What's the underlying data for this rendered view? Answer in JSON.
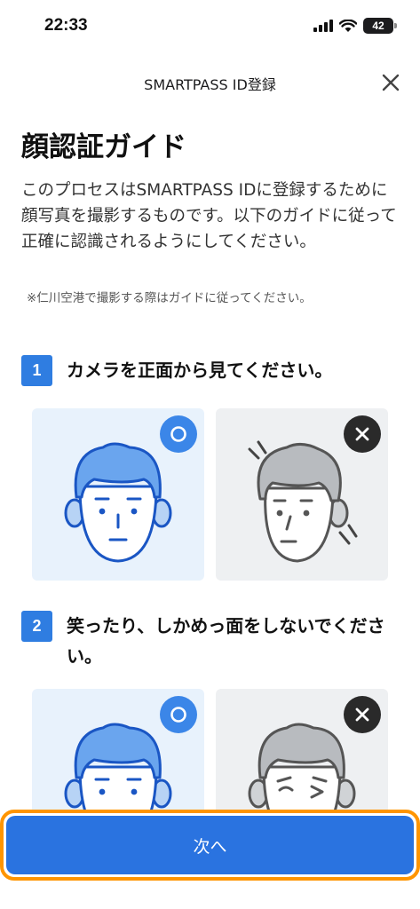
{
  "status": {
    "time": "22:33",
    "battery": "42"
  },
  "nav": {
    "title": "SMARTPASS ID登録"
  },
  "page": {
    "title": "顔認証ガイド",
    "intro": "このプロセスはSMARTPASS IDに登録するために顔写真を撮影するものです。以下のガイドに従って正確に認識されるようにしてください。",
    "note": "※仁川空港で撮影する際はガイドに従ってください。"
  },
  "steps": [
    {
      "number": "1",
      "text": "カメラを正面から見てください。"
    },
    {
      "number": "2",
      "text": "笑ったり、しかめっ面をしないでください。"
    }
  ],
  "footer": {
    "next_label": "次へ"
  },
  "colors": {
    "accent": "#2a73e0",
    "highlight_border": "#ff9500",
    "good_card": "#e8f2fc",
    "bad_card": "#eef0f2"
  },
  "icons": {
    "good": "circle-ok-icon",
    "bad": "cross-ng-icon"
  }
}
